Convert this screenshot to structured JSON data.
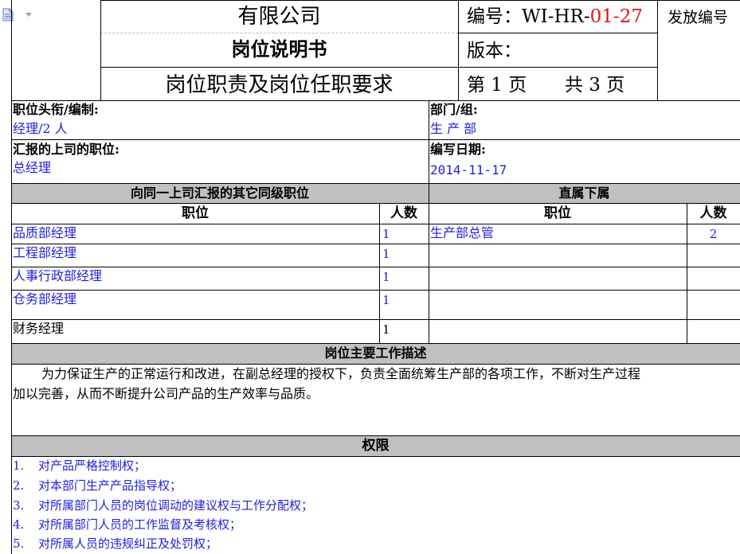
{
  "header": {
    "company": "有限公司",
    "doc_title": "岗位说明书",
    "subtitle": "岗位职责及岗位任职要求",
    "code_label": "编号：WI-HR-",
    "code_value": "01-27",
    "version_label": "版本：",
    "page_text": "第 1 页",
    "total_pages_text": "共 3 页",
    "issue_label": "发放编号"
  },
  "job_info": {
    "title_label": "职位头衔/编制:",
    "title_value": "经理/2 人",
    "dept_label": "部门/组:",
    "dept_value": "生 产 部",
    "reports_label": "汇报的上司的职位:",
    "reports_value": "总经理",
    "date_label": "编写日期:",
    "date_value": "2014-11-17"
  },
  "peers": {
    "header": "向同一上司汇报的其它同级职位",
    "col_position": "职位",
    "col_count": "人数",
    "rows": [
      {
        "position": "品质部经理",
        "count": "1"
      },
      {
        "position": "工程部经理",
        "count": "1"
      },
      {
        "position": "人事行政部经理",
        "count": "1"
      },
      {
        "position": "仓务部经理",
        "count": "1"
      },
      {
        "position": "财务经理",
        "count": "1"
      }
    ]
  },
  "subordinates": {
    "header": "直属下属",
    "col_position": "职位",
    "col_count": "人数",
    "rows": [
      {
        "position": "生产部总管",
        "count": "2"
      }
    ]
  },
  "description": {
    "header": "岗位主要工作描述",
    "line1": "为力保证生产的正常运行和改进，在副总经理的授权下，负责全面统筹生产部的各项工作，不断对生产过程",
    "line2": "加以完善，从而不断提升公司产品的生产效率与品质。"
  },
  "authority": {
    "header": "权限",
    "items": [
      {
        "num": "1.",
        "text": "对产品严格控制权；"
      },
      {
        "num": "2.",
        "text": "对本部门生产产品指导权；"
      },
      {
        "num": "3.",
        "text": "对所属部门人员的岗位调动的建议权与工作分配权；"
      },
      {
        "num": "4.",
        "text": "对所属部门人员的工作监督及考核权；"
      },
      {
        "num": "5.",
        "text": "对所属人员的违规纠正及处罚权；"
      }
    ]
  },
  "colors": {
    "section_header_bg": "#c0c0c0",
    "value_text": "#1f1fdb",
    "code_highlight": "#e0141a"
  }
}
